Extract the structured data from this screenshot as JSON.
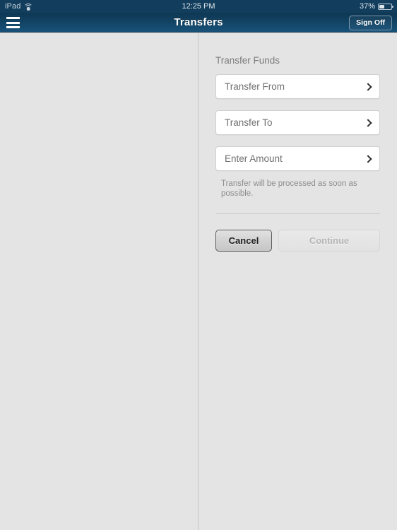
{
  "statusbar": {
    "device": "iPad",
    "wifi_icon": "wifi-icon",
    "time": "12:25 PM",
    "battery_percent": "37%",
    "battery_icon": "battery-icon",
    "battery_level": 37
  },
  "navbar": {
    "menu_icon": "hamburger-menu-icon",
    "title": "Transfers",
    "sign_off_label": "Sign Off",
    "background_color": "#134566"
  },
  "detail": {
    "section_title": "Transfer Funds",
    "fields": [
      {
        "label": "Transfer From",
        "icon": "chevron-right-icon"
      },
      {
        "label": "Transfer To",
        "icon": "chevron-right-icon"
      },
      {
        "label": "Enter Amount",
        "icon": "chevron-right-icon"
      }
    ],
    "helper_text": "Transfer will be processed as soon as possible.",
    "buttons": {
      "cancel_label": "Cancel",
      "continue_label": "Continue"
    }
  }
}
